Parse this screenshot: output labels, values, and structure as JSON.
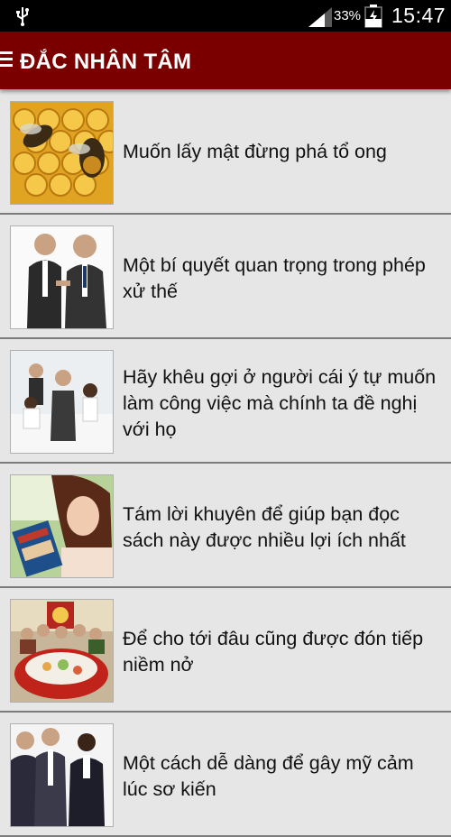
{
  "status": {
    "battery_percent": "33%",
    "time": "15:47",
    "icons": [
      "usb-icon",
      "signal-icon",
      "battery-icon"
    ]
  },
  "appbar": {
    "title": "ĐẮC NHÂN TÂM",
    "menu_icon": "hamburger-menu-icon",
    "color": "#7a0000"
  },
  "articles": [
    {
      "title": "Muốn lấy mật đừng phá tổ ong",
      "image": "honeycomb-bees"
    },
    {
      "title": "Một bí quyết quan trọng trong phép xử thế",
      "image": "businessmen-arguing"
    },
    {
      "title": "Hãy khêu gợi ở người cái ý tự muốn làm công việc mà chính ta đề nghị với họ",
      "image": "office-meeting"
    },
    {
      "title": "Tám lời khuyên để giúp bạn đọc sách này được nhiều lợi ích nhất",
      "image": "woman-reading-book"
    },
    {
      "title": "Để cho tới đâu cũng được đón tiếp niềm nở",
      "image": "family-dinner-table"
    },
    {
      "title": "Một cách dễ dàng để gây mỹ cảm lúc sơ kiến",
      "image": "business-people-meeting"
    }
  ]
}
